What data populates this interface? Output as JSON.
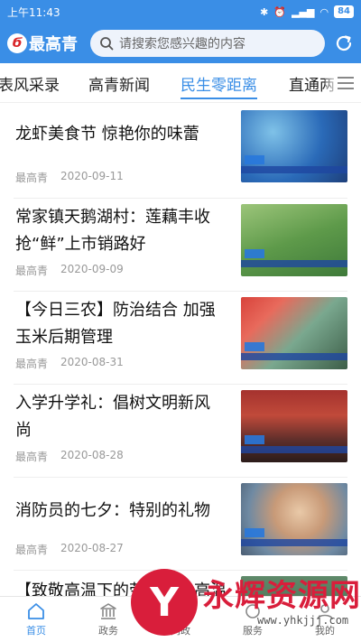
{
  "status_bar": {
    "time": "上午11:43",
    "battery": "84"
  },
  "app": {
    "logo_text": "最高青",
    "search_placeholder": "请搜索您感兴趣的内容"
  },
  "tabs": [
    {
      "label": "表风采录",
      "active": false
    },
    {
      "label": "高青新闻",
      "active": false
    },
    {
      "label": "民生零距离",
      "active": true
    },
    {
      "label": "直通两",
      "active": false
    }
  ],
  "articles": [
    {
      "title": "龙虾美食节 惊艳你的味蕾",
      "source": "最高青",
      "date": "2020-09-11"
    },
    {
      "title": "常家镇天鹅湖村：莲藕丰收抢“鲜”上市销路好",
      "source": "最高青",
      "date": "2020-09-09"
    },
    {
      "title": "【今日三农】防治结合 加强玉米后期管理",
      "source": "最高青",
      "date": "2020-08-31"
    },
    {
      "title": "入学升学礼：倡树文明新风尚",
      "source": "最高青",
      "date": "2020-08-28"
    },
    {
      "title": "消防员的七夕：特别的礼物",
      "source": "最高青",
      "date": "2020-08-27"
    },
    {
      "title": "【致敬高温下的劳动者】高温",
      "source": "",
      "date": ""
    }
  ],
  "bottom_nav": [
    {
      "label": "首页",
      "icon": "home-icon",
      "active": true
    },
    {
      "label": "政务",
      "icon": "government-icon",
      "active": false
    },
    {
      "label": "问政",
      "icon": "inquiry-icon",
      "active": false
    },
    {
      "label": "服务",
      "icon": "service-icon",
      "active": false
    },
    {
      "label": "我的",
      "icon": "profile-icon",
      "active": false
    }
  ],
  "watermark": {
    "name": "永辉资源网",
    "url": "www.yhkjjj.com"
  },
  "colors": {
    "primary": "#3a8ee6",
    "watermark": "#d91e3b"
  }
}
